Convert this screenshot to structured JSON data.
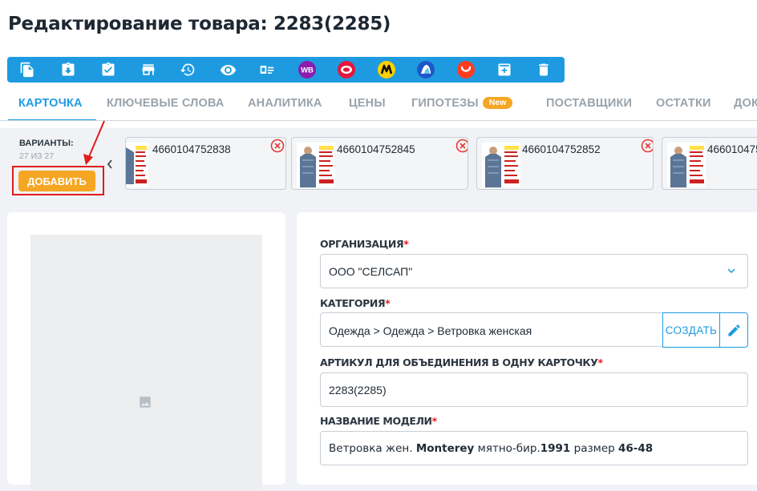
{
  "page": {
    "title": "Редактирование товара: 2283(2285)"
  },
  "toolbar": {
    "icons": [
      "copy-icon",
      "download-icon",
      "clipboard-check-icon",
      "store-icon",
      "history-icon",
      "eye-icon",
      "id-card-icon",
      "wildberries-logo-icon",
      "ozon-logo-icon",
      "yandex-market-logo-icon",
      "sbermegamarket-logo-icon",
      "aliexpress-logo-icon",
      "archive-add-icon",
      "trash-icon"
    ],
    "wb_text": "WB",
    "accent_color": "#1e9be0"
  },
  "tabs": [
    {
      "label": "КАРТОЧКА",
      "active": true
    },
    {
      "label": "КЛЮЧЕВЫЕ СЛОВА"
    },
    {
      "label": "АНАЛИТИКА"
    },
    {
      "label": "ЦЕНЫ"
    },
    {
      "label": "ГИПОТЕЗЫ",
      "badge": "New"
    },
    {
      "label": "ПОСТАВЩИКИ"
    },
    {
      "label": "ОСТАТКИ"
    },
    {
      "label": "ДОК"
    }
  ],
  "variants": {
    "label": "ВАРИАНТЫ:",
    "count": "27 ИЗ 27",
    "add_button": "ДОБАВИТЬ",
    "items": [
      {
        "code": "4660104752838"
      },
      {
        "code": "4660104752845"
      },
      {
        "code": "4660104752852"
      },
      {
        "code": "466010475"
      }
    ]
  },
  "form": {
    "organization": {
      "label": "ОРГАНИЗАЦИЯ",
      "value": "ООО \"СЕЛСАП\""
    },
    "category": {
      "label": "КАТЕГОРИЯ",
      "value": "Одежда > Одежда > Ветровка женская",
      "create_button": "СОЗДАТЬ"
    },
    "article": {
      "label": "АРТИКУЛ ДЛЯ ОБЪЕДИНЕНИЯ В ОДНУ КАРТОЧКУ",
      "value": "2283(2285)"
    },
    "model_name": {
      "label": "НАЗВАНИЕ МОДЕЛИ",
      "value_parts": [
        "Ветровка жен. ",
        "Monterey",
        " мятно-бир.",
        "1991",
        " размер ",
        "46-48"
      ]
    },
    "required_mark": "*"
  },
  "colors": {
    "accent": "#1e9be0",
    "orange": "#f5a623",
    "required": "#e11b1b"
  }
}
